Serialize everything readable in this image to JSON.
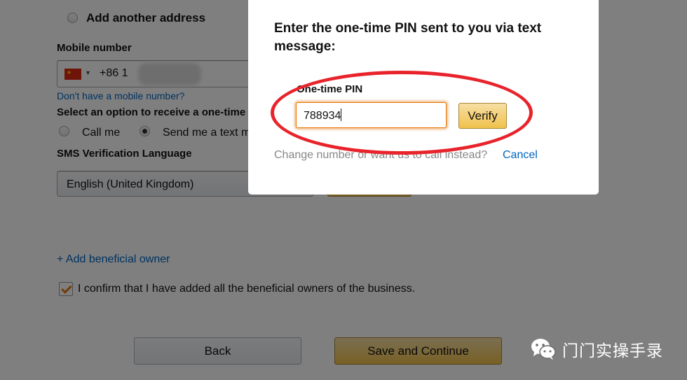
{
  "form": {
    "add_address_label": "Add another address",
    "mobile_label": "Mobile number",
    "country_code": "+86 1",
    "no_mobile_link": "Don't have a mobile number?",
    "receive_option_label": "Select an option to receive a one-time",
    "call_me_label": "Call me",
    "text_me_label": "Send me a text m",
    "sms_lang_label": "SMS Verification Language",
    "sms_lang_value": "English (United Kingdom)",
    "add_owner_link": "+ Add beneficial owner",
    "confirm_label": "I confirm that I have added all the beneficial owners of the business.",
    "confirm_checked": true,
    "back_label": "Back",
    "save_label": "Save and Continue"
  },
  "modal": {
    "title": "Enter the one-time PIN sent to you via text message:",
    "pin_label": "One-time PIN",
    "pin_value": "788934",
    "verify_label": "Verify",
    "help_text": "Change number or want us to call instead?",
    "cancel_label": "Cancel"
  },
  "watermark": {
    "text": "门门实操手录",
    "icon": "wechat-icon"
  },
  "colors": {
    "accent_gold": "#f0c14b",
    "link_blue": "#0066c0",
    "focus_orange": "#e77600",
    "annotation_red": "#e8232b"
  }
}
